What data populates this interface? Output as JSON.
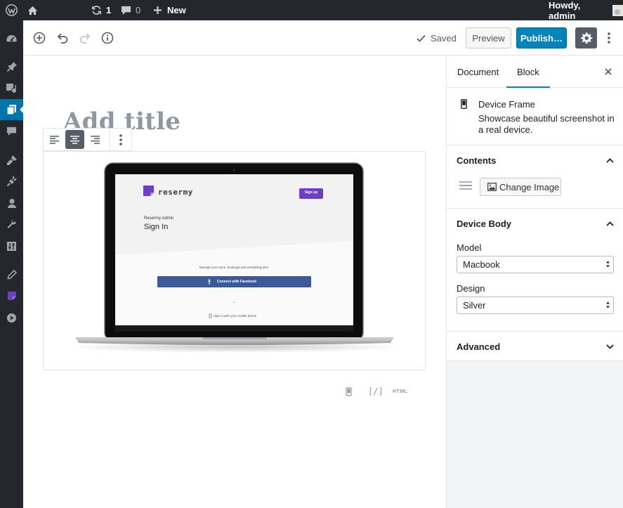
{
  "admin_bar": {
    "updates_count": "1",
    "comments_count": "0",
    "new_label": "New",
    "howdy": "Howdy, admin"
  },
  "header": {
    "saved_label": "Saved",
    "preview_label": "Preview",
    "publish_label": "Publish…"
  },
  "editor": {
    "title_placeholder": "Add title"
  },
  "device_screenshot": {
    "logo_text": "resermy",
    "signup_label": "Sign up",
    "heading_small": "Resermy Admin",
    "heading_large": "Sign In",
    "tagline": "Manage your store, bookings and everything else.",
    "facebook_button": "Connect with Facebook",
    "or_label": "or",
    "phone_link": "Sign in with your mobile phone"
  },
  "block_footer": {
    "html_label": "HTML",
    "shortcode_label": "[/]"
  },
  "sidebar": {
    "tab_document": "Document",
    "tab_block": "Block",
    "block_name": "Device Frame",
    "block_description": "Showcase beautiful screenshot in a real device.",
    "contents_heading": "Contents",
    "change_image_label": "Change Image",
    "device_body_heading": "Device Body",
    "model_label": "Model",
    "model_value": "Macbook",
    "design_label": "Design",
    "design_value": "Silver",
    "advanced_heading": "Advanced"
  },
  "colors": {
    "admin_bar_bg": "#23282d",
    "accent_blue": "#0085ba",
    "menu_active": "#0073aa",
    "brand_purple": "#6c3fc6"
  }
}
